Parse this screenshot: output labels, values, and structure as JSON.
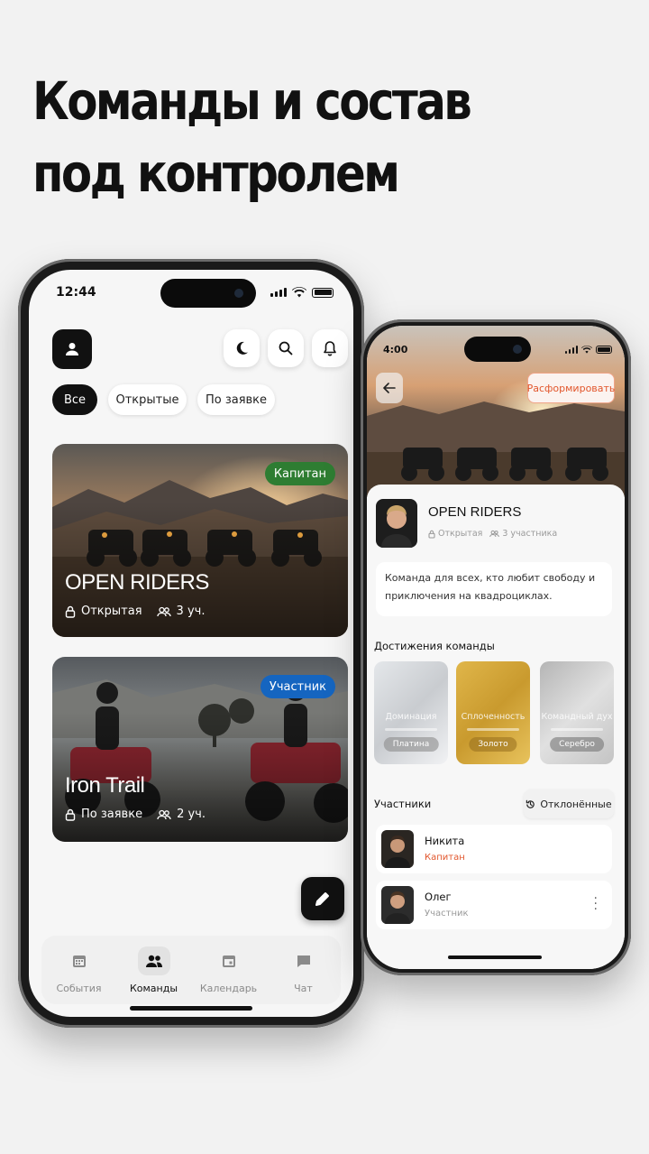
{
  "headline": {
    "line1": "Команды и состав",
    "line2": "под контролем"
  },
  "phone1": {
    "status": {
      "time": "12:44"
    },
    "filters": [
      "Все",
      "Открытые",
      "По заявке"
    ],
    "active_filter": "Все",
    "teams": [
      {
        "name": "OPEN RIDERS",
        "access": "Открытая",
        "members": "3 уч.",
        "role": "Капитан",
        "role_color": "#2e7d32"
      },
      {
        "name": "Iron Trail",
        "access": "По заявке",
        "members": "2 уч.",
        "role": "Участник",
        "role_color": "#1565c0"
      }
    ],
    "tabs": [
      {
        "label": "События",
        "icon": "calendar-grid-icon",
        "active": false
      },
      {
        "label": "Команды",
        "icon": "people-icon",
        "active": true
      },
      {
        "label": "Календарь",
        "icon": "calendar-icon",
        "active": false
      },
      {
        "label": "Чат",
        "icon": "chat-icon",
        "active": false
      }
    ]
  },
  "phone2": {
    "status": {
      "time": "4:00"
    },
    "disband_label": "Расформировать",
    "team": {
      "name": "OPEN RIDERS",
      "access": "Открытая",
      "members": "3 участника",
      "description": "Команда для всех, кто любит свободу и приключения на квадроциклах."
    },
    "achievements_title": "Достижения команды",
    "achievements": [
      {
        "name": "Доминация",
        "tier": "Платина"
      },
      {
        "name": "Сплоченность",
        "tier": "Золото"
      },
      {
        "name": "Командный дух",
        "tier": "Серебро"
      }
    ],
    "members_title": "Участники",
    "rejected_label": "Отклонённые",
    "members": [
      {
        "name": "Никита",
        "role": "Капитан",
        "role_color": "#e2562c"
      },
      {
        "name": "Олег",
        "role": "Участник",
        "role_color": "#9a9a9a"
      }
    ]
  },
  "colors": {
    "accent": "#e2562c",
    "captain": "#2e7d32",
    "member": "#1565c0"
  }
}
